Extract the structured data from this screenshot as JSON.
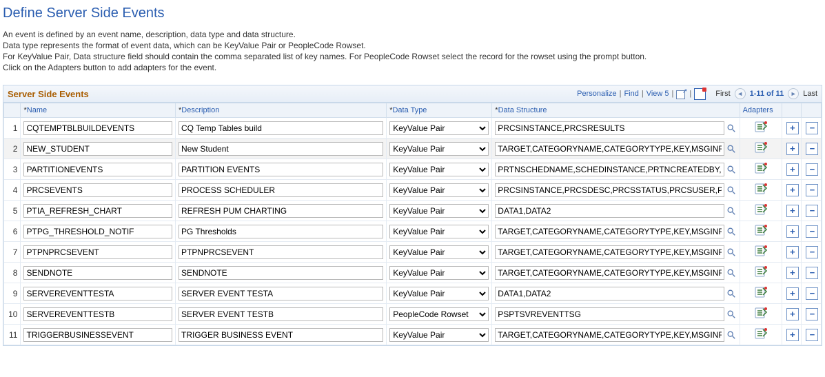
{
  "page": {
    "title": "Define Server Side Events",
    "intro": [
      "An event is defined by an event name, description, data type and data structure.",
      "Data type represents the format of event data, which can be KeyValue Pair or PeopleCode Rowset.",
      "For KeyValue Pair, Data structure field should contain the comma separated list of key names. For PeopleCode Rowset select the record for the rowset using the prompt button.",
      "Click on the Adapters button to add adapters for the event."
    ]
  },
  "grid": {
    "title": "Server Side Events",
    "toolbar": {
      "personalize": "Personalize",
      "find": "Find",
      "view5": "View 5",
      "first": "First",
      "count": "1-11 of 11",
      "last": "Last"
    },
    "columns": {
      "name": "Name",
      "description": "Description",
      "dataType": "Data Type",
      "dataStructure": "Data Structure",
      "adapters": "Adapters"
    },
    "dataTypeOptions": [
      "KeyValue Pair",
      "PeopleCode Rowset"
    ],
    "rows": [
      {
        "n": "1",
        "name": "CQTEMPTBLBUILDEVENTS",
        "desc": "CQ Temp Tables build",
        "type": "KeyValue Pair",
        "ds": "PRCSINSTANCE,PRCSRESULTS"
      },
      {
        "n": "2",
        "name": "NEW_STUDENT",
        "desc": "New Student",
        "type": "KeyValue Pair",
        "ds": "TARGET,CATEGORYNAME,CATEGORYTYPE,KEY,MSGINFO",
        "alt": true
      },
      {
        "n": "3",
        "name": "PARTITIONEVENTS",
        "desc": "PARTITION EVENTS",
        "type": "KeyValue Pair",
        "ds": "PRTNSCHEDNAME,SCHEDINSTANCE,PRTNCREATEDBY,P"
      },
      {
        "n": "4",
        "name": "PRCSEVENTS",
        "desc": "PROCESS SCHEDULER",
        "type": "KeyValue Pair",
        "ds": "PRCSINSTANCE,PRCSDESC,PRCSSTATUS,PRCSUSER,P"
      },
      {
        "n": "5",
        "name": "PTIA_REFRESH_CHART",
        "desc": "REFRESH PUM CHARTING",
        "type": "KeyValue Pair",
        "ds": "DATA1,DATA2"
      },
      {
        "n": "6",
        "name": "PTPG_THRESHOLD_NOTIF",
        "desc": "PG Thresholds",
        "type": "KeyValue Pair",
        "ds": "TARGET,CATEGORYNAME,CATEGORYTYPE,KEY,MSGINFO"
      },
      {
        "n": "7",
        "name": "PTPNPRCSEVENT",
        "desc": "PTPNPRCSEVENT",
        "type": "KeyValue Pair",
        "ds": "TARGET,CATEGORYNAME,CATEGORYTYPE,KEY,MSGINFO"
      },
      {
        "n": "8",
        "name": "SENDNOTE",
        "desc": "SENDNOTE",
        "type": "KeyValue Pair",
        "ds": "TARGET,CATEGORYNAME,CATEGORYTYPE,KEY,MSGINFO"
      },
      {
        "n": "9",
        "name": "SERVEREVENTTESTA",
        "desc": "SERVER EVENT TESTA",
        "type": "KeyValue Pair",
        "ds": "DATA1,DATA2"
      },
      {
        "n": "10",
        "name": "SERVEREVENTTESTB",
        "desc": "SERVER EVENT TESTB",
        "type": "PeopleCode Rowset",
        "ds": "PSPTSVREVENTTSG"
      },
      {
        "n": "11",
        "name": "TRIGGERBUSINESSEVENT",
        "desc": "TRIGGER BUSINESS EVENT",
        "type": "KeyValue Pair",
        "ds": "TARGET,CATEGORYNAME,CATEGORYTYPE,KEY,MSGINFO"
      }
    ]
  }
}
